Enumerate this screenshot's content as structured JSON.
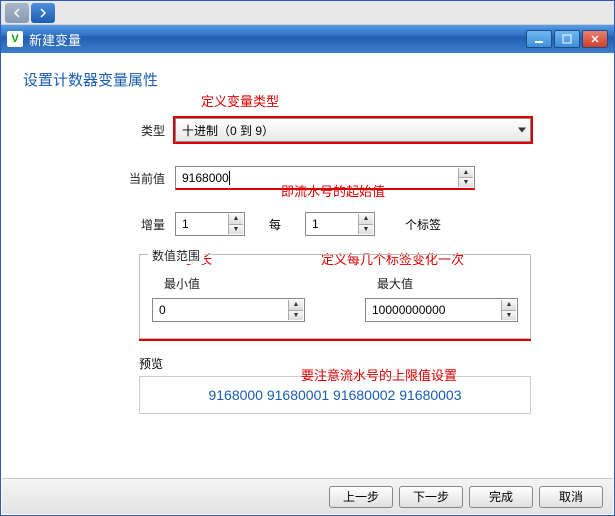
{
  "title": "新建变量",
  "icon_letter": "V",
  "heading": "设置计数器变量属性",
  "ann_type": "定义变量类型",
  "ann_start": "即流水号的起始值",
  "ann_step": "步长",
  "ann_per": "定义每几个标签变化一次",
  "ann_limit": "要注意流水号的上限值设置",
  "labels": {
    "type": "类型",
    "current": "当前值",
    "increment": "增量",
    "per": "每",
    "per_suffix": "个标签",
    "range": "数值范围",
    "min": "最小值",
    "max": "最大值",
    "preview": "预览"
  },
  "values": {
    "type": "十进制（0 到 9）",
    "current": "9168000",
    "increment": "1",
    "per": "1",
    "min": "0",
    "max": "10000000000"
  },
  "preview_text": "9168000 91680001 91680002 91680003",
  "buttons": {
    "prev": "上一步",
    "next": "下一步",
    "finish": "完成",
    "cancel": "取消"
  }
}
